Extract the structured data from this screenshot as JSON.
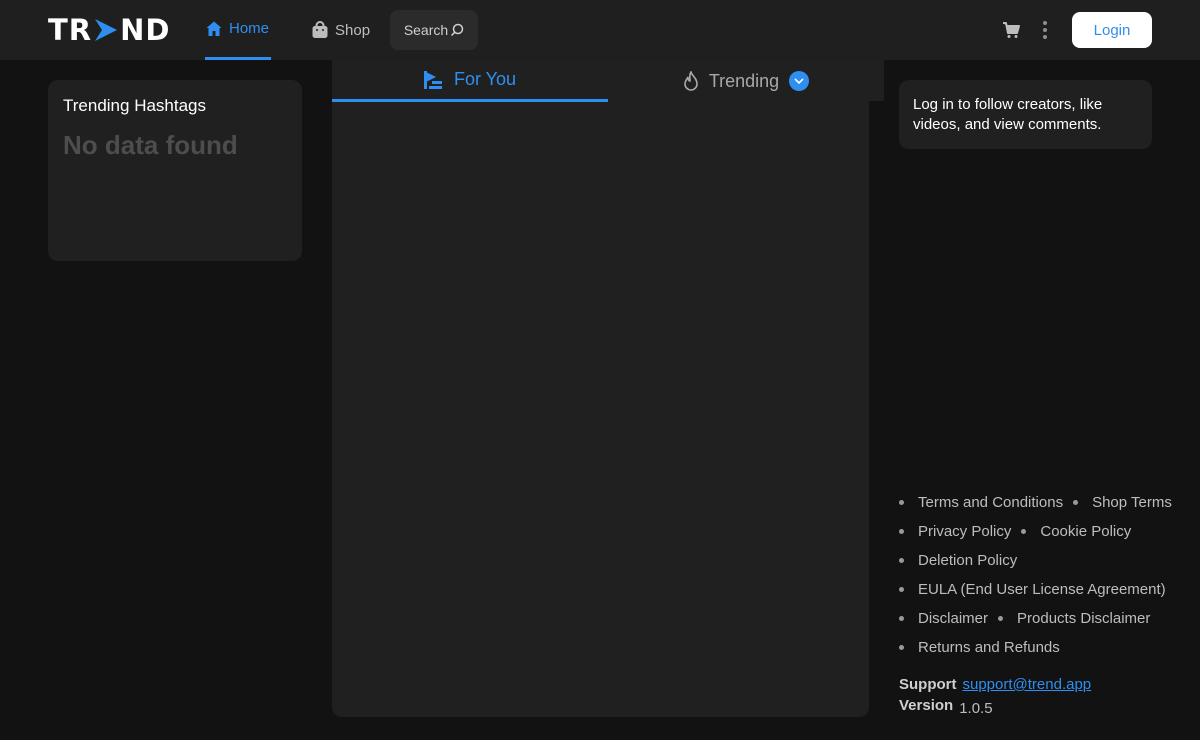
{
  "header": {
    "logo": {
      "left": "TR",
      "right": "ND"
    },
    "nav": [
      {
        "label": "Home",
        "icon": "home-icon",
        "active": true
      },
      {
        "label": "Shop",
        "icon": "shop-icon",
        "active": false
      }
    ],
    "search_label": "Search",
    "login_label": "Login"
  },
  "left": {
    "card_title": "Trending Hashtags",
    "empty_text": "No data found"
  },
  "center": {
    "tabs": [
      {
        "label": "For You",
        "icon": "for-you-icon",
        "active": true
      },
      {
        "label": "Trending",
        "icon": "flame-icon",
        "active": false
      }
    ]
  },
  "right": {
    "login_prompt": "Log in to follow creators, like videos, and view comments.",
    "footer_links": [
      [
        "Terms and Conditions",
        "Shop Terms"
      ],
      [
        "Privacy Policy",
        "Cookie Policy"
      ],
      [
        "Deletion Policy"
      ],
      [
        "EULA (End User License Agreement)"
      ],
      [
        "Disclaimer",
        "Products Disclaimer"
      ],
      [
        "Returns and Refunds"
      ]
    ],
    "support_label": "Support",
    "support_email": "support@trend.app",
    "version_label": "Version",
    "version_value": "1.0.5"
  },
  "colors": {
    "accent": "#2f8ff0",
    "background": "#121212",
    "panel": "#202020"
  }
}
